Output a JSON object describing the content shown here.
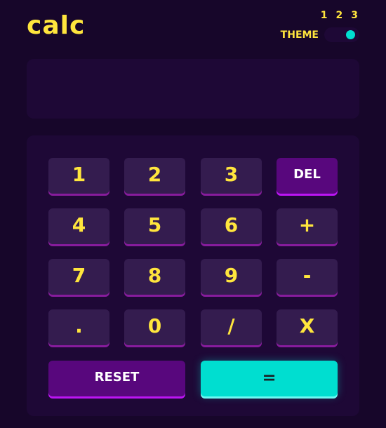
{
  "header": {
    "logo": "calc",
    "theme_label": "THEME",
    "theme_options": [
      "1",
      "2",
      "3"
    ],
    "theme_selected": "3"
  },
  "display": {
    "value": ""
  },
  "keys": {
    "k1": "1",
    "k2": "2",
    "k3": "3",
    "del": "DEL",
    "k4": "4",
    "k5": "5",
    "k6": "6",
    "plus": "+",
    "k7": "7",
    "k8": "8",
    "k9": "9",
    "minus": "-",
    "dot": ".",
    "k0": "0",
    "divide": "/",
    "multiply": "X",
    "reset": "RESET",
    "equals": "="
  },
  "colors": {
    "background": "#17062a",
    "panel": "#1e0836",
    "key": "#341c4f",
    "key_shadow": "#871c9c",
    "accent_text": "#ffe53d",
    "special_key": "#58077d",
    "equals_key": "#00ded0"
  }
}
